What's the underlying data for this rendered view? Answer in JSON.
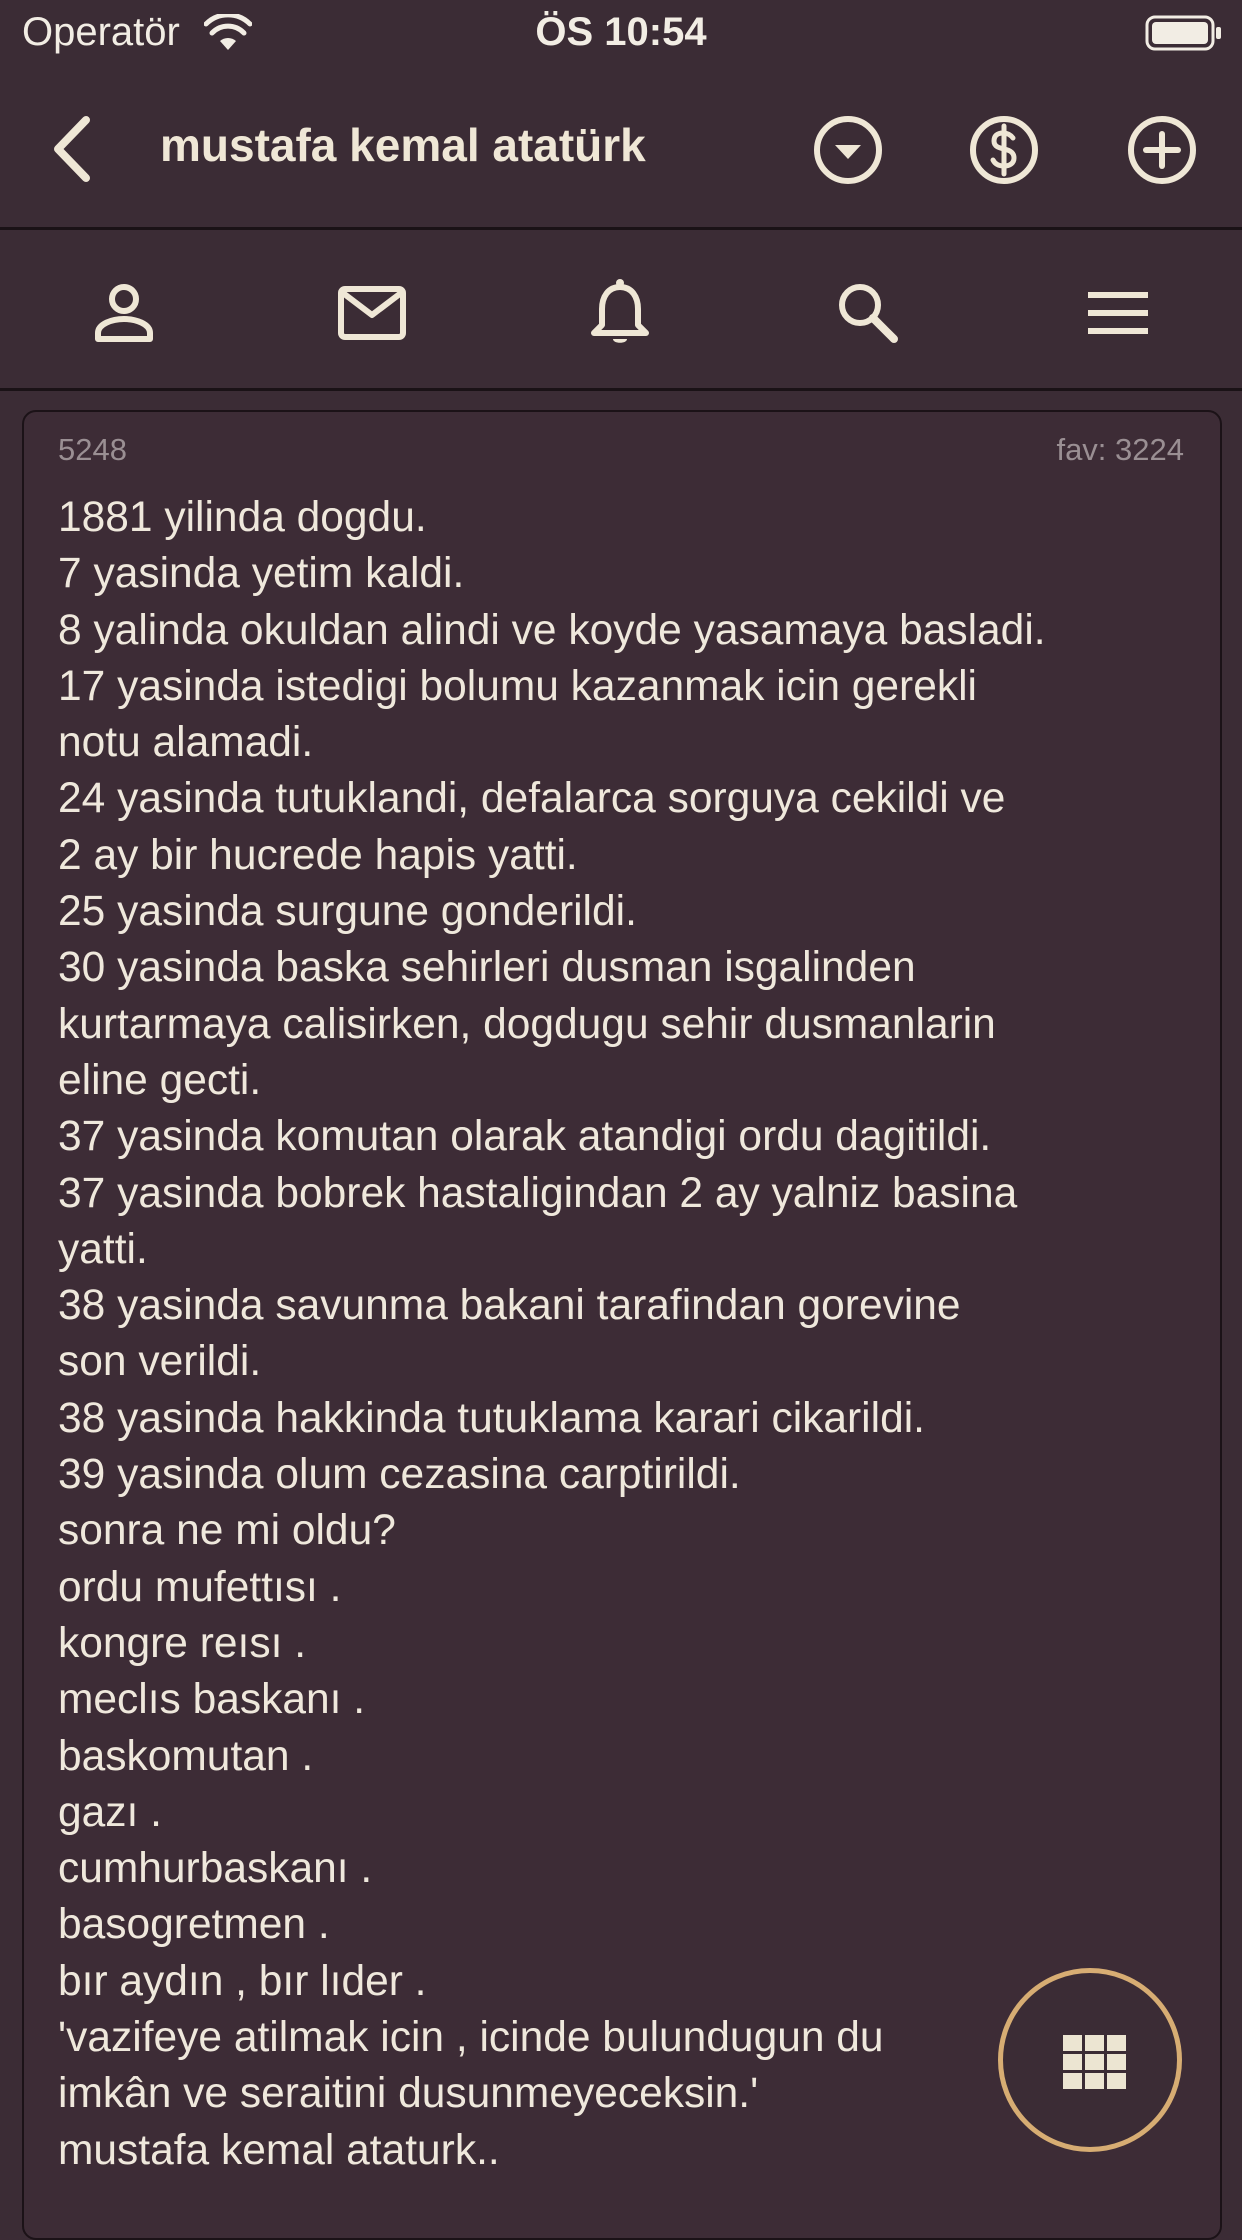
{
  "status_bar": {
    "carrier": "Operatör",
    "time": "ÖS 10:54"
  },
  "nav": {
    "title": "mustafa kemal atatürk",
    "icons": [
      "back-icon",
      "chevron-down-circle-icon",
      "dollar-circle-icon",
      "plus-circle-icon"
    ]
  },
  "toolbar": {
    "icons": [
      "user-icon",
      "mail-icon",
      "bell-icon",
      "search-icon",
      "menu-icon"
    ]
  },
  "entry": {
    "id": "5248",
    "fav": "fav: 3224",
    "lines": [
      "1881 yilinda dogdu.",
      "7 yasinda yetim kaldi.",
      "8 yalinda okuldan alindi ve koyde yasamaya basladi.",
      "17 yasinda istedigi bolumu kazanmak icin gerekli",
      "notu alamadi.",
      "24 yasinda tutuklandi, defalarca sorguya cekildi ve",
      "2 ay bir hucrede hapis yatti.",
      "25 yasinda surgune gonderildi.",
      "30 yasinda baska sehirleri dusman isgalinden",
      "kurtarmaya calisirken, dogdugu sehir dusmanlarin",
      "eline gecti.",
      "37 yasinda komutan olarak atandigi ordu dagitildi.",
      "37 yasinda bobrek hastaligindan 2 ay yalniz basina",
      "yatti.",
      "38 yasinda savunma bakani tarafindan gorevine",
      "son verildi.",
      "38 yasinda hakkinda tutuklama karari cikarildi.",
      "39 yasinda olum cezasina carptirildi.",
      "sonra ne mi oldu?",
      "ordu mufettısı .",
      "kongre reısı .",
      "meclıs baskanı .",
      "baskomutan .",
      "gazı .",
      "cumhurbaskanı .",
      "basogretmen .",
      "bır aydın , bır lıder .",
      "'vazifeye atilmak icin , icinde bulundugun du",
      "imkân ve seraitini dusunmeyeceksin.'",
      "mustafa kemal ataturk.."
    ]
  },
  "fab": {
    "icon": "grid-icon"
  },
  "colors": {
    "background": "#3b2c35",
    "text": "#efe8dc",
    "muted": "#9a8f93",
    "fab_ring": "#d7ad73"
  }
}
